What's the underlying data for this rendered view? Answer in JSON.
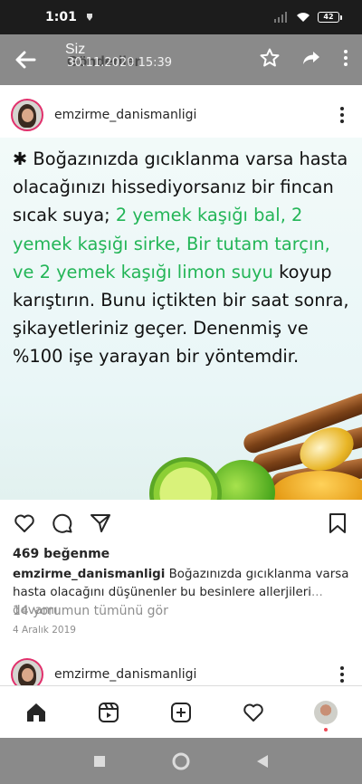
{
  "status_bar": {
    "time": "1:01",
    "battery": "42",
    "icons": [
      "app-notification-icon",
      "signal-icon",
      "wifi-icon",
      "battery-icon"
    ]
  },
  "app_bar": {
    "title": "Siz",
    "subtitle_overlap": "Gönderiler",
    "date": "30.11.2020 15:39",
    "icons": [
      "back-arrow-icon",
      "star-icon",
      "share-icon",
      "more-vert-icon"
    ]
  },
  "post": {
    "username": "emzirme_danismanligi",
    "image_text": {
      "star": "✱",
      "line1": " Boğazınızda gıcıklanma varsa hasta olacağınızı hissediyorsanız bir fincan sıcak suya; ",
      "green": "2 yemek kaşığı bal, 2 yemek kaşığı sirke, Bir tutam tarçın, ve 2 yemek kaşığı limon suyu",
      "line2": " koyup karıştırın. Bunu içtikten bir saat sonra, şikayetleriniz geçer. Denenmiş ve %100 işe yarayan bir yöntemdir."
    },
    "likes": "469 beğenme",
    "caption_user": "emzirme_danismanligi",
    "caption_text": " Boğazınızda gıcıklanma varsa hasta olacağını düşünenler bu besinlere  allerjileri",
    "caption_more": "... devamı",
    "comments_link": "14 yorumun tümünü gör",
    "date": "4 Aralık 2019"
  },
  "next_post": {
    "username": "emzirme_danismanligi"
  },
  "bottom_nav": {
    "icons": [
      "home-icon",
      "reels-icon",
      "new-post-icon",
      "activity-heart-icon",
      "profile-avatar"
    ]
  },
  "system_nav": {
    "icons": [
      "recents-square-icon",
      "home-circle-icon",
      "back-triangle-icon"
    ]
  },
  "colors": {
    "status_bg": "#1c1c1c",
    "overlay_gray": "#8a8a8a",
    "green_text": "#23b557",
    "story_ring": "#e1306c",
    "notification_dot": "#ed4956"
  }
}
